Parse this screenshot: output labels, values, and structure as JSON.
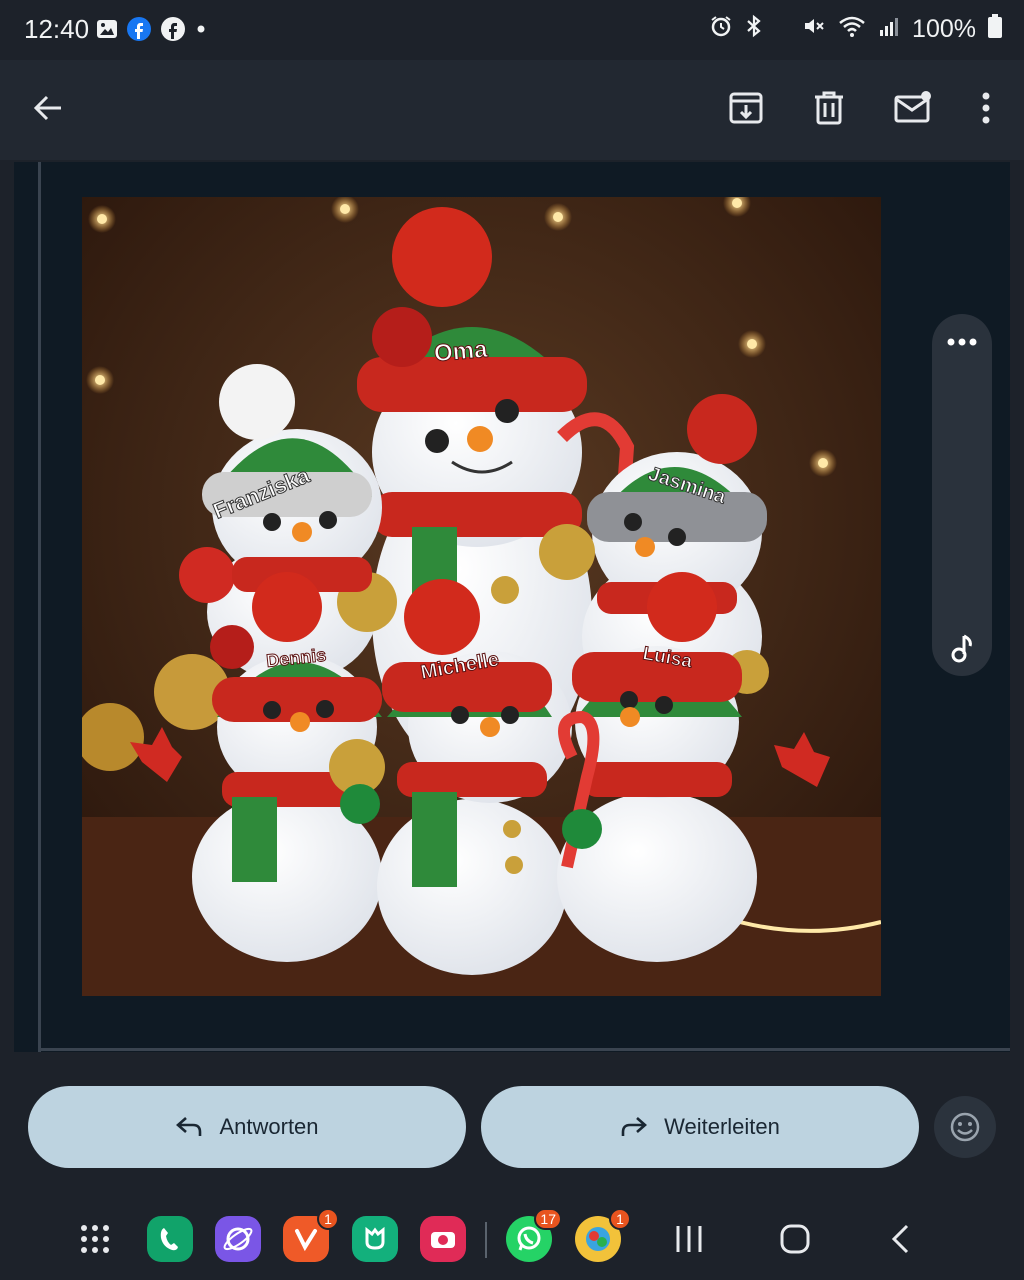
{
  "status_bar": {
    "time": "12:40",
    "battery": "100%",
    "left_icons": [
      "image-icon",
      "facebook-messenger-icon",
      "facebook-icon",
      "dot-icon"
    ],
    "right_icons": [
      "alarm-icon",
      "bluetooth-icon",
      "mute-icon",
      "wifi-icon",
      "signal-icon",
      "battery-icon"
    ]
  },
  "toolbar": {
    "icons": [
      "back-arrow-icon",
      "archive-icon",
      "delete-icon",
      "mark-unread-icon",
      "more-vert-icon"
    ]
  },
  "image": {
    "labels": {
      "oma": "Oma",
      "franziska": "Franziska",
      "jasmina": "Jasmina",
      "dennis": "Dennis",
      "michelle": "Michelle",
      "luisa": "Luisa"
    }
  },
  "side_panel": {
    "icons": [
      "more-horiz-icon",
      "music-note-icon"
    ]
  },
  "actions": {
    "reply_label": "Antworten",
    "forward_label": "Weiterleiten"
  },
  "dock": {
    "apps": [
      {
        "name": "phone",
        "color": "#11a36a"
      },
      {
        "name": "internet",
        "color": "#7a56e6"
      },
      {
        "name": "vivaldi",
        "color": "#ef5a28",
        "badge": "1"
      },
      {
        "name": "app-green",
        "color": "#13b07c"
      },
      {
        "name": "screen-recorder",
        "color": "#e02b57"
      },
      {
        "name": "whatsapp",
        "color": "#25d366",
        "badge": "17"
      },
      {
        "name": "game",
        "color": "#f2c23a",
        "badge": "1"
      }
    ]
  }
}
